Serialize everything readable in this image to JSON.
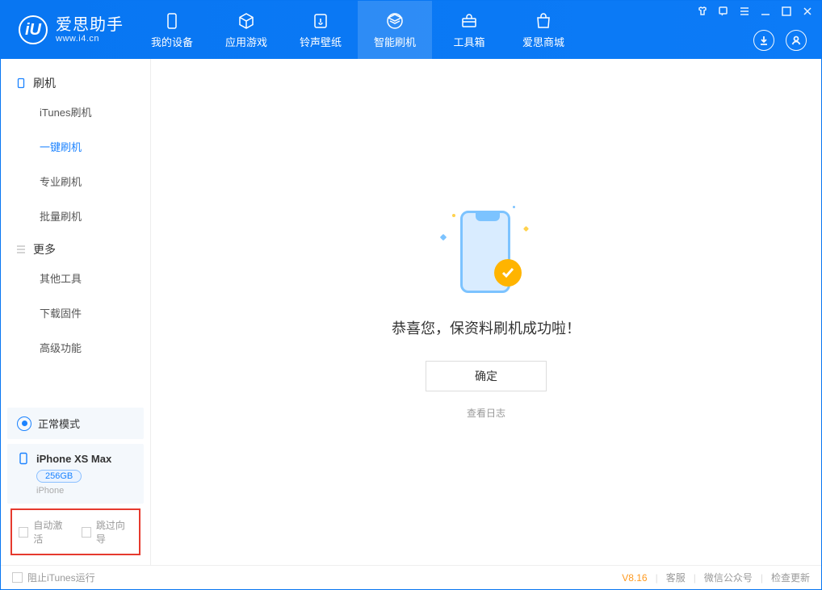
{
  "app": {
    "title": "爱思助手",
    "site": "www.i4.cn",
    "logo_letter": "iU"
  },
  "tabs": {
    "device": "我的设备",
    "apps": "应用游戏",
    "ring": "铃声壁纸",
    "flash": "智能刷机",
    "tools": "工具箱",
    "store": "爱思商城"
  },
  "sidebar": {
    "group_flash": "刷机",
    "items_flash": {
      "itunes": "iTunes刷机",
      "onekey": "一键刷机",
      "pro": "专业刷机",
      "batch": "批量刷机"
    },
    "group_more": "更多",
    "items_more": {
      "other": "其他工具",
      "download": "下载固件",
      "advanced": "高级功能"
    }
  },
  "device_panel": {
    "mode": "正常模式",
    "name": "iPhone XS Max",
    "storage": "256GB",
    "sub": "iPhone"
  },
  "checks": {
    "auto_activate": "自动激活",
    "skip_guide": "跳过向导"
  },
  "main": {
    "success": "恭喜您，保资料刷机成功啦！",
    "ok": "确定",
    "log": "查看日志"
  },
  "footer": {
    "block_itunes": "阻止iTunes运行",
    "version": "V8.16",
    "cs": "客服",
    "wechat": "微信公众号",
    "update": "检查更新"
  }
}
